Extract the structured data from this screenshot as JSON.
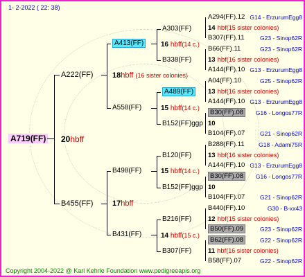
{
  "header": "1-  2-2022 ( 22: 38)",
  "footer": "Copyright 2004-2022 @ Karl Kehrle Foundation     www.pedigreeapis.org",
  "root": {
    "name": "A719(FF)",
    "num": "20",
    "suffix": "hbff"
  },
  "gen2": [
    {
      "name": "A222(FF)",
      "num": "18",
      "suffix": "hbff",
      "note": "(16 sister colonies)"
    },
    {
      "name": "B455(FF)",
      "num": "17",
      "suffix": "hbff",
      "note": ""
    }
  ],
  "gen3": [
    {
      "name": "A413(FF)",
      "num": "16",
      "suffix": "hbff",
      "note": "(14 c.)"
    },
    {
      "name": "A558(FF)",
      "num": "15",
      "suffix": "hbff",
      "note": "(14 c.)"
    },
    {
      "name": "B498(FF)",
      "num": "15",
      "suffix": "hbff",
      "note": "(14 c.)"
    },
    {
      "name": "B431(FF)",
      "num": "14",
      "suffix": "hbff",
      "note": "(15 c.)"
    }
  ],
  "gen4": [
    {
      "name": "A303(FF)",
      "num": "",
      "suffix": "",
      "note": ""
    },
    {
      "name": "B338(FF)",
      "num": "",
      "suffix": "",
      "note": ""
    },
    {
      "name": "A489(FF)",
      "num": "",
      "suffix": "",
      "note": ""
    },
    {
      "name": "B152(FF)ggp",
      "num": "",
      "suffix": "",
      "note": ""
    },
    {
      "name": "B120(FF)",
      "num": "",
      "suffix": "",
      "note": ""
    },
    {
      "name": "B152(FF)ggp",
      "num": "",
      "suffix": "",
      "note": ""
    },
    {
      "name": "B216(FF)",
      "num": "",
      "suffix": "",
      "note": ""
    },
    {
      "name": "B307(FF)",
      "num": "",
      "suffix": "",
      "note": ""
    }
  ],
  "gen4_nums": [
    {
      "num": "",
      "suffix": ""
    },
    {
      "num": "",
      "suffix": ""
    },
    {
      "num": "",
      "suffix": ""
    },
    {
      "num": "",
      "suffix": ""
    },
    {
      "num": "",
      "suffix": ""
    },
    {
      "num": "",
      "suffix": ""
    },
    {
      "num": "",
      "suffix": ""
    },
    {
      "num": "",
      "suffix": ""
    }
  ],
  "gen5": [
    {
      "name": "A294(FF).12",
      "info": "G14 - ErzurumEgg8"
    },
    {
      "num": "14",
      "suffix": "hbf",
      "note": "(15 sister colonies)"
    },
    {
      "name": "B307(FF).11",
      "info": "G23 - Sinop62R"
    },
    {
      "name": "B66(FF).11",
      "info": "G23 - Sinop62R"
    },
    {
      "num": "13",
      "suffix": "hbf",
      "note": "(16 sister colonies)"
    },
    {
      "name": "A144(FF).10",
      "info": "G13 - ErzurumEgg8"
    },
    {
      "name": "A04(FF).10",
      "info": "G25 - Sinop62R"
    },
    {
      "num": "13",
      "suffix": "hbf",
      "note": "(16 sister colonies)"
    },
    {
      "name": "A144(FF).10",
      "info": "G13 - ErzurumEgg8"
    },
    {
      "name": "B30(FF).08",
      "info": "G16 - Longos77R"
    },
    {
      "num": "10",
      "suffix": "",
      "note": ""
    },
    {
      "name": "B104(FF).07",
      "info": "G21 - Sinop62R"
    },
    {
      "name": "B288(FF).11",
      "info": "G18 - Adami75R"
    },
    {
      "num": "13",
      "suffix": "hbf",
      "note": "(16 sister colonies)"
    },
    {
      "name": "A144(FF).10",
      "info": "G13 - ErzurumEgg8"
    },
    {
      "name": "B30(FF).08",
      "info": "G16 - Longos77R"
    },
    {
      "num": "10",
      "suffix": "",
      "note": ""
    },
    {
      "name": "B104(FF).07",
      "info": "G21 - Sinop62R"
    },
    {
      "name": "B440(FF).10",
      "info": "G30 - B-xx43"
    },
    {
      "num": "12",
      "suffix": "hbf",
      "note": "(15 sister colonies)"
    },
    {
      "name": "B50(FF).09",
      "info": "G23 - Sinop62R"
    },
    {
      "name": "B62(FF).08",
      "info": "G22 - Sinop62R"
    },
    {
      "num": "11",
      "suffix": "hbf",
      "note": "(16 sister colonies)"
    },
    {
      "name": "B58(FF).07",
      "info": "G22 - Sinop62R"
    }
  ]
}
